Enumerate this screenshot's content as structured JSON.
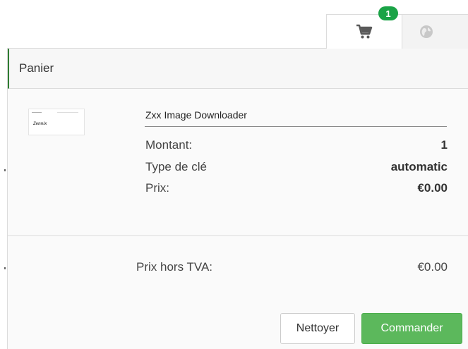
{
  "tabs": {
    "cart_badge": "1",
    "cart_icon": "cart-icon",
    "globe_icon": "globe-icon"
  },
  "panel": {
    "title": "Panier"
  },
  "product": {
    "title": "Zxx Image Downloader",
    "thumbnail_logo": "Zennix",
    "rows": [
      {
        "label": "Montant:",
        "value": "1"
      },
      {
        "label": "Type de clé",
        "value": "automatic"
      },
      {
        "label": "Prix:",
        "value": "€0.00"
      }
    ]
  },
  "totals": {
    "label": "Prix hors TVA:",
    "value": "€0.00"
  },
  "actions": {
    "clear_label": "Nettoyer",
    "order_label": "Commander"
  },
  "colors": {
    "badge": "#1aa346",
    "order_button": "#5cb85c",
    "header_accent": "#2e7d32"
  }
}
